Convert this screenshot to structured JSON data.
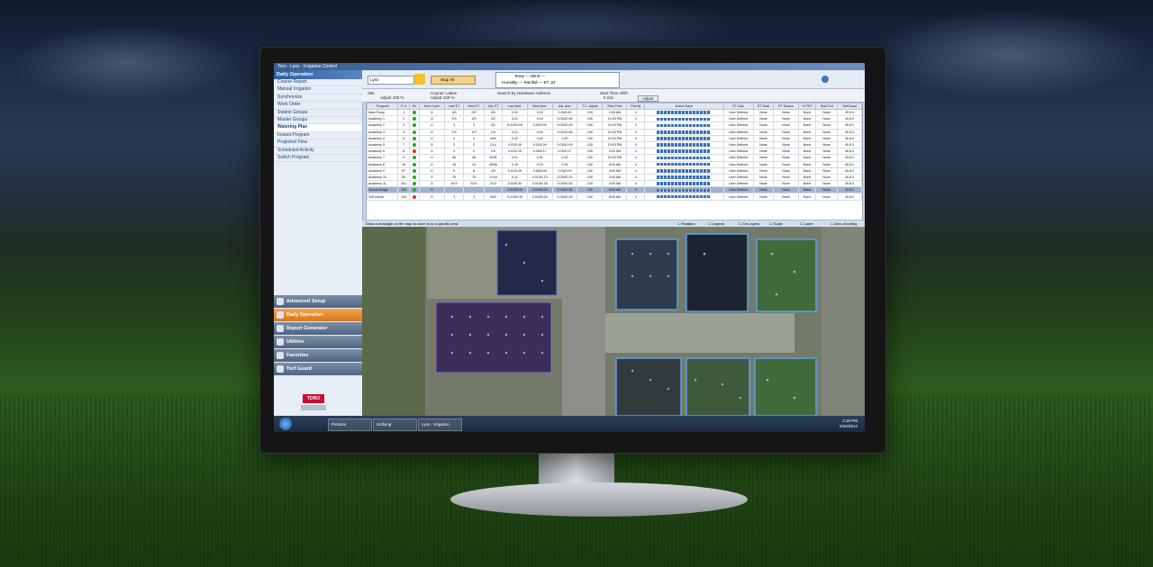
{
  "window_title": "Toro · Lynx · Irrigation Control",
  "sidebar": {
    "header": "Daily Operation",
    "items": [
      "Course Report",
      "Manual Irrigation",
      "Synchronize",
      "Work Order",
      "Station Groups",
      "Master Groups",
      "Watering Plan",
      "Instant Program",
      "Projected Flow",
      "Scheduled Activity",
      "Switch Program"
    ],
    "active_index": 6,
    "nav": [
      "Advanced Setup",
      "Daily Operation",
      "Report Generator",
      "Utilities",
      "Favorites",
      "Turf Guard"
    ],
    "nav_active_index": 1,
    "brand": "TORO"
  },
  "toolbar": {
    "select_value": "Lynx",
    "stop_label": "Stop All",
    "weather_line1": "Temp — Wind —",
    "weather_line2": "Humidity — Rainfall — ET .24"
  },
  "filters": {
    "site": "Site",
    "adjust": "Adjust 100 %",
    "course": "Course: Lakes",
    "course_adjust": "Adjust 100 %",
    "search": "Search By Hardware Address",
    "start_time": "Start Time Shift",
    "start_val": "0 min",
    "adjust_btn": "Adjust"
  },
  "table": {
    "headers": [
      "Program",
      "P. #",
      "On",
      "Auto Cycle",
      "Last ET",
      "Next ET",
      "Adj. ET",
      "Last Amt.",
      "Next Amt.",
      "Adj. Amt.",
      "T.C. Adjust",
      "Start Time",
      "Priority",
      "Active Days",
      "ET Calc",
      "ET Multi",
      "ET Source",
      "% FET",
      "Start Cut",
      "TurfGuard"
    ],
    "rows": [
      {
        "name": "Main Pump",
        "p": "1",
        "on": "g",
        "lastet": "0/0",
        "nextet": "0/0",
        "adjet": "0/0",
        "last": "0.20",
        "next": "0.20",
        "adj": "0.25/0.49",
        "tc": "100",
        "start": "2:45 AM",
        "pri": "4",
        "calc": "User Defined",
        "multi": "None",
        "src": "None",
        "fet": "None",
        "cut": "None",
        "tg": "40.9.0"
      },
      {
        "name": "Academy 1",
        "p": "2",
        "on": "g",
        "lastet": "1/9",
        "nextet": "1/9",
        "adjet": "0/2",
        "last": "0.01",
        "next": "0.04",
        "adj": "0.015/0.06",
        "tc": "100",
        "start": "10:00 PM",
        "pri": "4",
        "calc": "User Defined",
        "multi": "None",
        "src": "None",
        "fet": "None",
        "cut": "None",
        "tg": "40.8.0"
      },
      {
        "name": "Academy 2",
        "p": "3",
        "on": "g",
        "lastet": "3",
        "nextet": "3",
        "adjet": "2/1",
        "last": "0.015/0.09",
        "next": "0.03/0.09",
        "adj": "0.015/0.09",
        "tc": "100",
        "start": "10:00 PM",
        "pri": "4",
        "calc": "User Defined",
        "multi": "None",
        "src": "None",
        "fet": "None",
        "cut": "None",
        "tg": "40.8.0"
      },
      {
        "name": "Academy 3",
        "p": "4",
        "on": "g",
        "lastet": "1/9",
        "nextet": "1/9",
        "adjet": "1/9",
        "last": "0.01",
        "next": "0.04",
        "adj": "0.015/0.06",
        "tc": "100",
        "start": "10:30 PM",
        "pri": "4",
        "calc": "User Defined",
        "multi": "None",
        "src": "None",
        "fet": "None",
        "cut": "None",
        "tg": "40.8.0"
      },
      {
        "name": "Academy 4",
        "p": "5",
        "on": "g",
        "lastet": "0",
        "nextet": "0",
        "adjet": "0/00",
        "last": "0.00",
        "next": "0.00",
        "adj": "0.00",
        "tc": "100",
        "start": "10:00 PM",
        "pri": "4",
        "calc": "User Defined",
        "multi": "None",
        "src": "None",
        "fet": "None",
        "cut": "None",
        "tg": "40.8.0"
      },
      {
        "name": "Academy 5",
        "p": "7",
        "on": "g",
        "lastet": "2",
        "nextet": "2",
        "adjet": "1/14",
        "last": "0.02/0.09",
        "next": "0.03/0.09",
        "adj": "0.015/0.09",
        "tc": "100",
        "start": "10:00 PM",
        "pri": "4",
        "calc": "User Defined",
        "multi": "None",
        "src": "None",
        "fet": "None",
        "cut": "None",
        "tg": "40.8.0"
      },
      {
        "name": "Academy 6",
        "p": "8",
        "on": "r",
        "lastet": "0",
        "nextet": "0",
        "adjet": "1/9",
        "last": "0.02/0.15",
        "next": "0.06/0.17",
        "adj": "0.02/0.17",
        "tc": "100",
        "start": "3:00 AM",
        "pri": "4",
        "calc": "User Defined",
        "multi": "None",
        "src": "None",
        "fet": "None",
        "cut": "None",
        "tg": "40.8.0"
      },
      {
        "name": "Academy 7",
        "p": "9",
        "on": "g",
        "lastet": "46",
        "nextet": "46",
        "adjet": "0/0/8",
        "last": "0.01",
        "next": "0.01",
        "adj": "0.01",
        "tc": "100",
        "start": "10:00 PM",
        "pri": "4",
        "calc": "User Defined",
        "multi": "None",
        "src": "None",
        "fet": "None",
        "cut": "None",
        "tg": "40.8.0"
      },
      {
        "name": "Academy 8",
        "p": "10",
        "on": "g",
        "lastet": "15",
        "nextet": "15",
        "adjet": "39/06",
        "last": "0.15",
        "next": "0.15",
        "adj": "0.15",
        "tc": "100",
        "start": "8:00 AM",
        "pri": "4",
        "calc": "User Defined",
        "multi": "None",
        "src": "None",
        "fet": "None",
        "cut": "None",
        "tg": "40.8.0"
      },
      {
        "name": "Academy 9",
        "p": "57",
        "on": "g",
        "lastet": "6",
        "nextet": "6",
        "adjet": "2/9",
        "last": "0.01/0.09",
        "next": "0.06/0.09",
        "adj": "0.03/0.09",
        "tc": "100",
        "start": "4:00 AM",
        "pri": "4",
        "calc": "User Defined",
        "multi": "None",
        "src": "None",
        "fet": "None",
        "cut": "None",
        "tg": "40.8.0"
      },
      {
        "name": "Academy 10",
        "p": "59",
        "on": "g",
        "lastet": "75",
        "nextet": "75",
        "adjet": "71/04",
        "last": "0.11",
        "next": "0.015/0.13",
        "adj": "0.015/0.13",
        "tc": "100",
        "start": "3:00 AM",
        "pri": "4",
        "calc": "User Defined",
        "multi": "None",
        "src": "None",
        "fet": "None",
        "cut": "None",
        "tg": "40.8.0"
      },
      {
        "name": "Academy 11",
        "p": "101",
        "on": "g",
        "lastet": "5/13",
        "nextet": "5/13",
        "adjet": "2/13",
        "last": "0.02/0.30",
        "next": "0.015/0.30",
        "adj": "0.015/0.30",
        "tc": "100",
        "start": "4:03 AM",
        "pri": "4",
        "calc": "User Defined",
        "multi": "None",
        "src": "None",
        "fet": "None",
        "cut": "None",
        "tg": "40.8.0"
      },
      {
        "name": "Tennis Bridge",
        "p": "103",
        "on": "g",
        "lastet": "",
        "nextet": "",
        "adjet": "",
        "last": "0.015/0.30",
        "next": "0.015/0.30",
        "adj": "0.015/0.30",
        "tc": "100",
        "start": "8:00 AM",
        "pri": "4",
        "calc": "User Defined",
        "multi": "None",
        "src": "None",
        "fet": "None",
        "cut": "None",
        "tg": "40.8.0"
      },
      {
        "name": "Turf Admin",
        "p": "104",
        "on": "r",
        "lastet": "3",
        "nextet": "3",
        "adjet": "0/00",
        "last": "0.015/0.30",
        "next": "0.015/0.30",
        "adj": "0.015/0.30",
        "tc": "100",
        "start": "8:00 AM",
        "pri": "4",
        "calc": "User Defined",
        "multi": "None",
        "src": "None",
        "fet": "None",
        "cut": "None",
        "tg": "40.8.0"
      }
    ],
    "selected_index": 12
  },
  "map": {
    "hint": "Draw a rectangle on the map to zoom in to a specific area",
    "options": [
      "Rotation",
      "Legend",
      "On Layers",
      "Scale",
      "Label",
      "Auto Zooming"
    ],
    "tools_select": "Area",
    "reset_label": "Reset the map"
  },
  "taskbar": {
    "items": [
      "Pictures",
      "Unifying",
      "Lynx - Irrigation"
    ],
    "time": "2:18 PM",
    "date": "9/26/2014"
  }
}
